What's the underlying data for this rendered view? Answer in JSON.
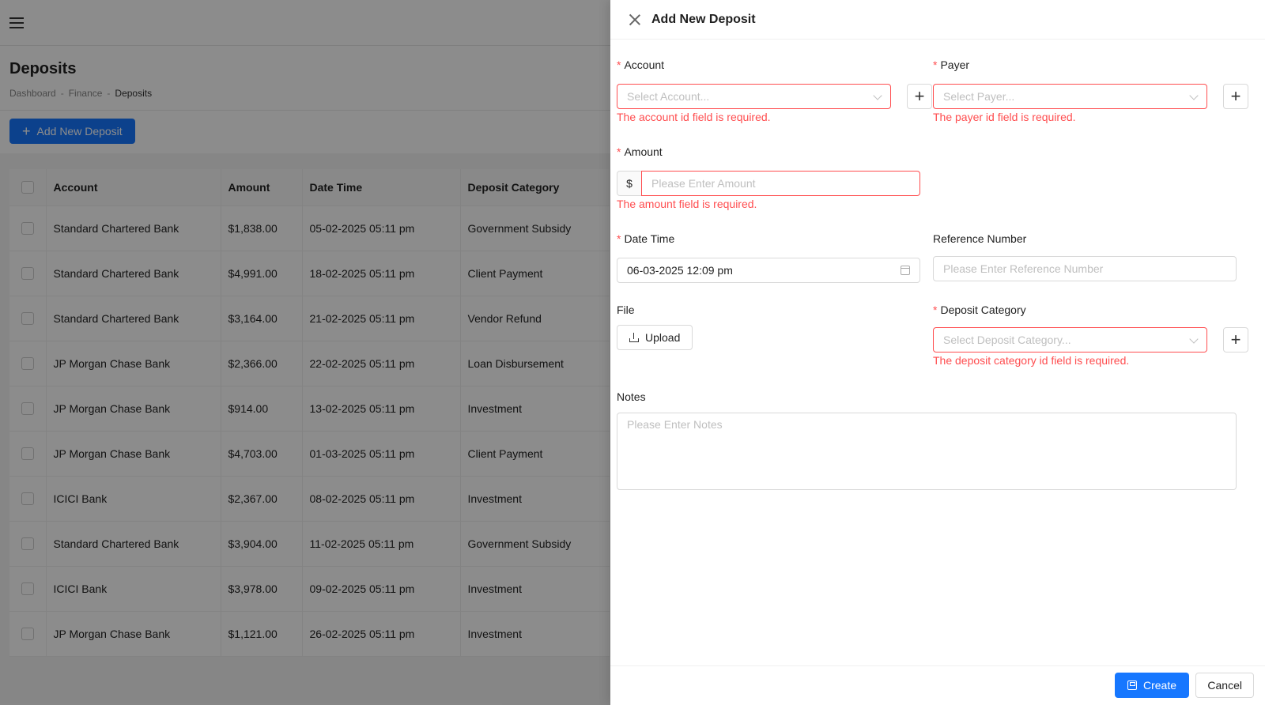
{
  "page": {
    "title": "Deposits",
    "breadcrumb": [
      "Dashboard",
      "Finance",
      "Deposits"
    ],
    "breadcrumb_sep": "-",
    "add_button": "Add New Deposit"
  },
  "table": {
    "headers": [
      "Account",
      "Amount",
      "Date Time",
      "Deposit Category"
    ],
    "rows": [
      [
        "Standard Chartered Bank",
        "$1,838.00",
        "05-02-2025 05:11 pm",
        "Government Subsidy"
      ],
      [
        "Standard Chartered Bank",
        "$4,991.00",
        "18-02-2025 05:11 pm",
        "Client Payment"
      ],
      [
        "Standard Chartered Bank",
        "$3,164.00",
        "21-02-2025 05:11 pm",
        "Vendor Refund"
      ],
      [
        "JP Morgan Chase Bank",
        "$2,366.00",
        "22-02-2025 05:11 pm",
        "Loan Disbursement"
      ],
      [
        "JP Morgan Chase Bank",
        "$914.00",
        "13-02-2025 05:11 pm",
        "Investment"
      ],
      [
        "JP Morgan Chase Bank",
        "$4,703.00",
        "01-03-2025 05:11 pm",
        "Client Payment"
      ],
      [
        "ICICI Bank",
        "$2,367.00",
        "08-02-2025 05:11 pm",
        "Investment"
      ],
      [
        "Standard Chartered Bank",
        "$3,904.00",
        "11-02-2025 05:11 pm",
        "Government Subsidy"
      ],
      [
        "ICICI Bank",
        "$3,978.00",
        "09-02-2025 05:11 pm",
        "Investment"
      ],
      [
        "JP Morgan Chase Bank",
        "$1,121.00",
        "26-02-2025 05:11 pm",
        "Investment"
      ]
    ]
  },
  "drawer": {
    "title": "Add New Deposit",
    "required_mark": "*",
    "account": {
      "label": "Account",
      "placeholder": "Select Account...",
      "error": "The account id field is required."
    },
    "payer": {
      "label": "Payer",
      "placeholder": "Select Payer...",
      "error": "The payer id field is required."
    },
    "amount": {
      "label": "Amount",
      "prefix": "$",
      "placeholder": "Please Enter Amount",
      "error": "The amount field is required."
    },
    "date_time": {
      "label": "Date Time",
      "value": "06-03-2025 12:09 pm"
    },
    "reference": {
      "label": "Reference Number",
      "placeholder": "Please Enter Reference Number"
    },
    "file": {
      "label": "File",
      "button": "Upload"
    },
    "category": {
      "label": "Deposit Category",
      "placeholder": "Select Deposit Category...",
      "error": "The deposit category id field is required."
    },
    "notes": {
      "label": "Notes",
      "placeholder": "Please Enter Notes"
    },
    "plus_glyph": "+",
    "create_button": "Create",
    "cancel_button": "Cancel"
  },
  "colors": {
    "primary": "#1677ff",
    "error": "#ff4d4f",
    "overlay": "rgba(0,0,0,0.45)"
  }
}
